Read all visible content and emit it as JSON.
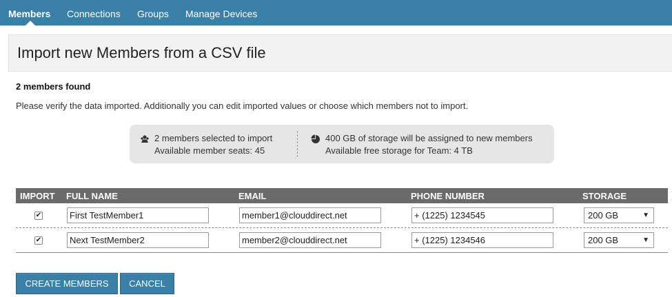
{
  "nav": {
    "tabs": [
      {
        "label": "Members",
        "active": true
      },
      {
        "label": "Connections",
        "active": false
      },
      {
        "label": "Groups",
        "active": false
      },
      {
        "label": "Manage Devices",
        "active": false
      }
    ]
  },
  "page": {
    "title": "Import new Members from a CSV file",
    "found": "2 members found",
    "description": "Please verify the data imported. Additionally you can edit imported values or choose which members not to import."
  },
  "summary": {
    "selected": "2 members selected to import",
    "seats": "Available member seats: 45",
    "storage_assigned": "400 GB of storage will be assigned to new members",
    "storage_free": "Available free storage for Team: 4 TB",
    "icons": [
      "users-icon",
      "pie-chart-icon"
    ]
  },
  "table": {
    "headers": [
      "IMPORT",
      "FULL NAME",
      "EMAIL",
      "PHONE NUMBER",
      "STORAGE"
    ],
    "rows": [
      {
        "import": true,
        "name": "First TestMember1",
        "email": "member1@clouddirect.net",
        "phone": "+ (1225) 1234545",
        "storage": "200 GB"
      },
      {
        "import": true,
        "name": "Next TestMember2",
        "email": "member2@clouddirect.net",
        "phone": "+ (1225) 1234546",
        "storage": "200 GB"
      }
    ]
  },
  "buttons": {
    "create": "CREATE MEMBERS",
    "cancel": "CANCEL"
  },
  "colors": {
    "nav": "#3a7fa6",
    "table_header": "#6b6b6b",
    "button": "#3a7fa6"
  }
}
